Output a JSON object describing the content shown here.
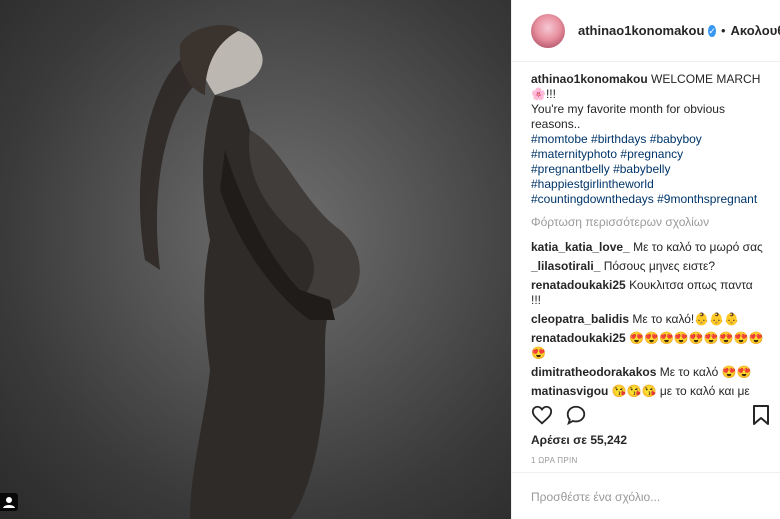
{
  "post": {
    "username": "athinao1konomakou",
    "follow_label": "Ακολουθείτ",
    "separator": "•",
    "verified_icon": "verified-badge-icon"
  },
  "caption": {
    "username": "athinao1konomakou",
    "text_1": "WELCOME MARCH",
    "emoji": "🌸!!!",
    "text_2": "You're my favorite month for obvious reasons..",
    "hashtags": [
      "#momtobe",
      "#birthdays",
      "#babyboy",
      "#maternityphoto",
      "#pregnancy",
      "#pregnantbelly",
      "#babybelly",
      "#happiestgirlintheworld",
      "#countingdownthedays",
      "#9monthspregnant"
    ]
  },
  "load_more_label": "Φόρτωση περισσότερων σχολίων",
  "comments": [
    {
      "user": "katia_katia_love_",
      "text": "Με το καλό το μωρό σας"
    },
    {
      "user": "_lilasotirali_",
      "text": "Πόσους μηνες ειστε?"
    },
    {
      "user": "renatadoukaki25",
      "text": "Κουκλιτσα οπως παντα !!!"
    },
    {
      "user": "cleopatra_balidis",
      "text": "Με το καλό!👶👶👶"
    },
    {
      "user": "renatadoukaki25",
      "text": "😍😍😍😍😍😍😍😍😍😍"
    },
    {
      "user": "dimitratheodorakakos",
      "text": "Με το καλό 😍😍"
    },
    {
      "user": "matinasvigou",
      "text": "😘😘😘 με το καλό και με"
    }
  ],
  "likes_label": "Αρέσει σε 55,242",
  "time_label": "1 ΩΡΑ ΠΡΙΝ",
  "add_comment_placeholder": "Προσθέστε ένα σχόλιο...",
  "icons": {
    "like": "heart-icon",
    "comment": "speech-bubble-icon",
    "save": "bookmark-icon",
    "tag": "person-tag-icon"
  }
}
